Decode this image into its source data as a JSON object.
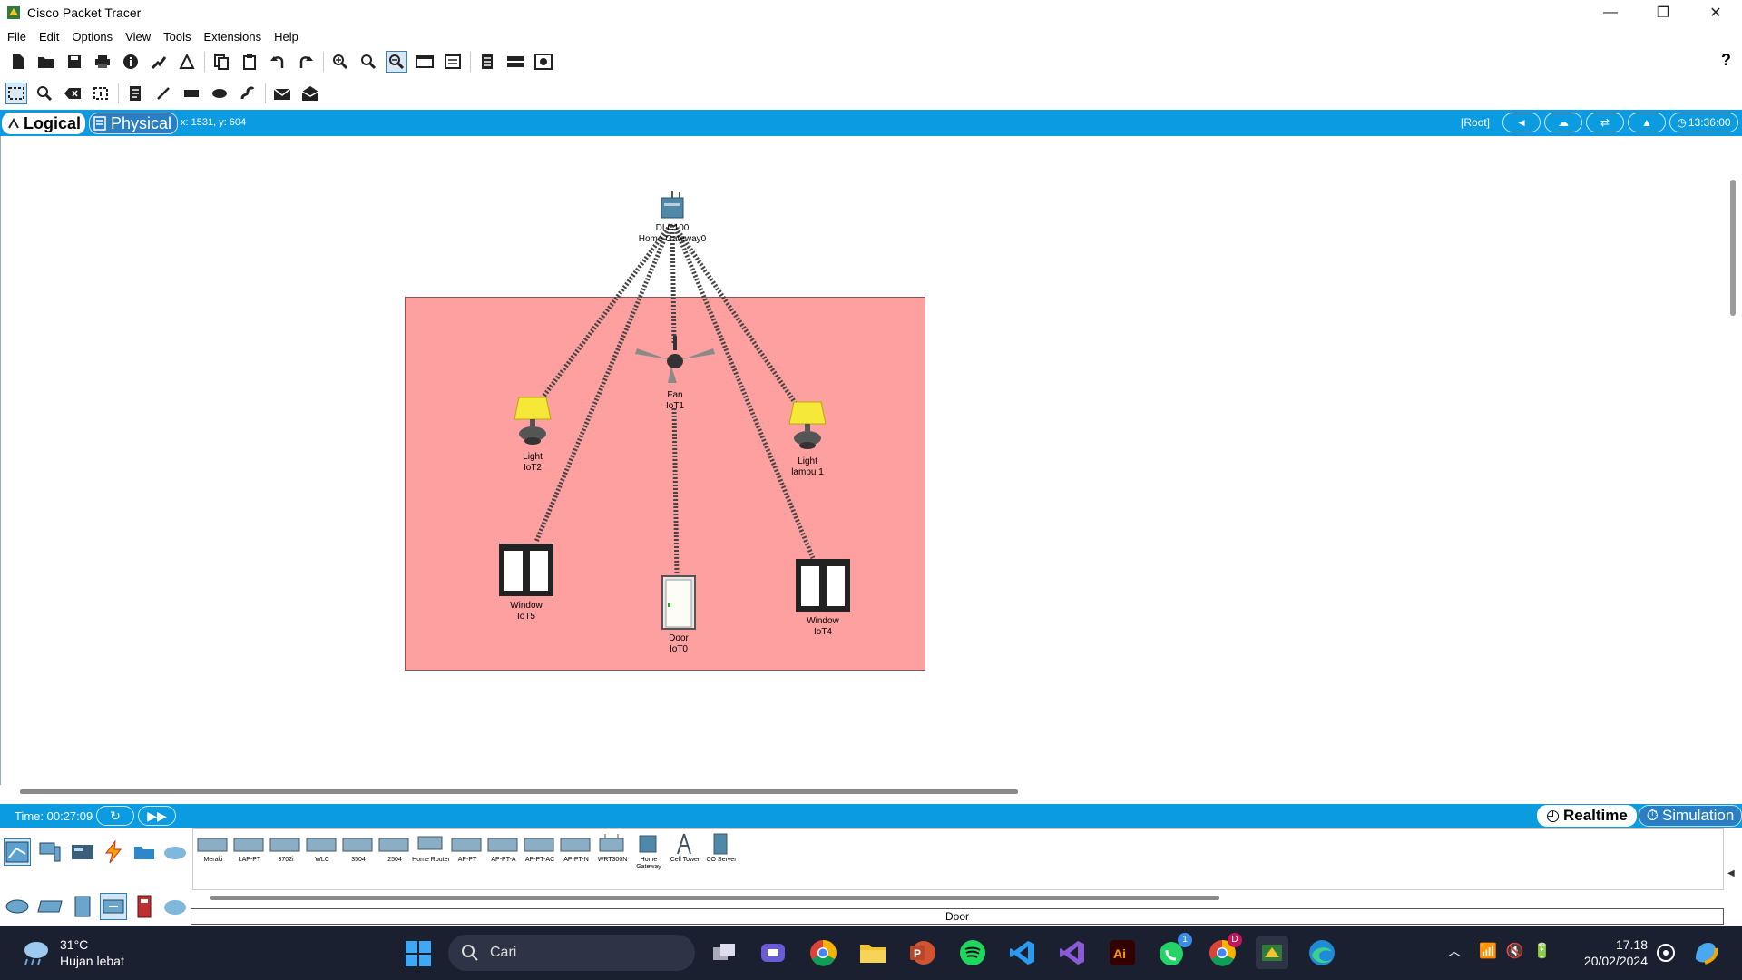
{
  "window": {
    "title": "Cisco Packet Tracer",
    "minimize": "—",
    "restore": "❐",
    "close": "✕"
  },
  "menu": [
    "File",
    "Edit",
    "Options",
    "View",
    "Tools",
    "Extensions",
    "Help"
  ],
  "toolbar1_icons": [
    "new-file-icon",
    "open-icon",
    "save-icon",
    "print-icon",
    "info-icon",
    "activity-wizard-icon",
    "custom-pdu-icon",
    "copy-icon",
    "paste-icon",
    "undo-icon",
    "redo-icon",
    "zoom-in-icon",
    "zoom-reset-icon",
    "zoom-out-icon",
    "drawing-palette-icon",
    "device-template-icon",
    "cluster-icon",
    "network-info-icon",
    "viewport-icon"
  ],
  "toolbar2_icons": [
    "select-icon",
    "inspect-icon",
    "delete-icon",
    "resize-icon",
    "note-icon",
    "line-icon",
    "rectangle-icon",
    "ellipse-icon",
    "freeform-icon",
    "add-simple-pdu-icon",
    "add-complex-pdu-icon"
  ],
  "help": "?",
  "workspace": {
    "tab_logical": "Logical",
    "tab_physical": "Physical",
    "coords": "x: 1531, y: 604",
    "root": "[Root]",
    "clock": "13:36:00"
  },
  "devices": [
    {
      "id": "gateway",
      "line1": "DLC100",
      "line2": "Home Gateway0"
    },
    {
      "id": "fan",
      "line1": "Fan",
      "line2": "IoT1"
    },
    {
      "id": "light2",
      "line1": "Light",
      "line2": "IoT2"
    },
    {
      "id": "light1",
      "line1": "Light",
      "line2": "lampu 1"
    },
    {
      "id": "window5",
      "line1": "Window",
      "line2": "IoT5"
    },
    {
      "id": "door",
      "line1": "Door",
      "line2": "IoT0"
    },
    {
      "id": "window4",
      "line1": "Window",
      "line2": "IoT4"
    }
  ],
  "sim": {
    "time": "Time: 00:27:09",
    "realtime": "Realtime",
    "simulation": "Simulation"
  },
  "device_list": [
    "Meraki",
    "LAP-PT",
    "3702i",
    "WLC",
    "3504",
    "2504",
    "Home Router",
    "AP-PT",
    "AP-PT-A",
    "AP-PT-AC",
    "AP-PT-N",
    "WRT300N",
    "Home Gateway",
    "Cell Tower",
    "CO Server"
  ],
  "status": "Door",
  "taskbar": {
    "temp": "31°C",
    "weather": "Hujan lebat",
    "search_placeholder": "Cari",
    "time": "17.18",
    "date": "20/02/2024",
    "whatsapp_badge": "1",
    "chrome_badge": "D"
  },
  "colors": {
    "accent": "#0a9be0",
    "room": "#ffa0a0",
    "taskbar": "#1b2031"
  }
}
